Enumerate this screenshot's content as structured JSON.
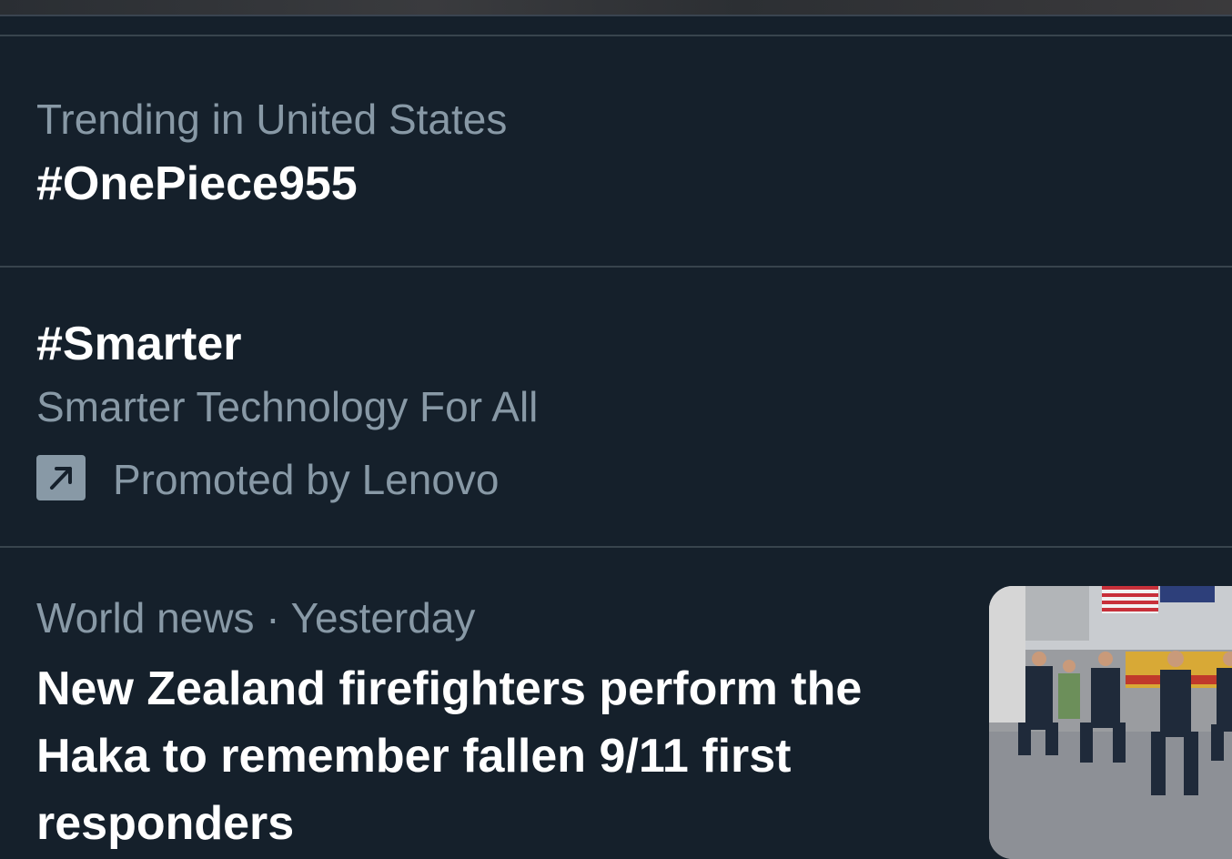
{
  "trends": [
    {
      "context": "Trending in United States",
      "title": "#OnePiece955"
    },
    {
      "title": "#Smarter",
      "description": "Smarter Technology For All",
      "promoted": "Promoted by Lenovo",
      "icon": "promoted-arrow-icon"
    }
  ],
  "news": {
    "meta": "World news · Yesterday",
    "headline": "New Zealand firefighters perform the Haka to remember fallen 9/11 first responders",
    "thumbnail": "firefighters-haka-thumbnail"
  },
  "colors": {
    "background": "#15202b",
    "divider": "#38444d",
    "secondary_text": "#8899a6",
    "primary_text": "#ffffff"
  }
}
